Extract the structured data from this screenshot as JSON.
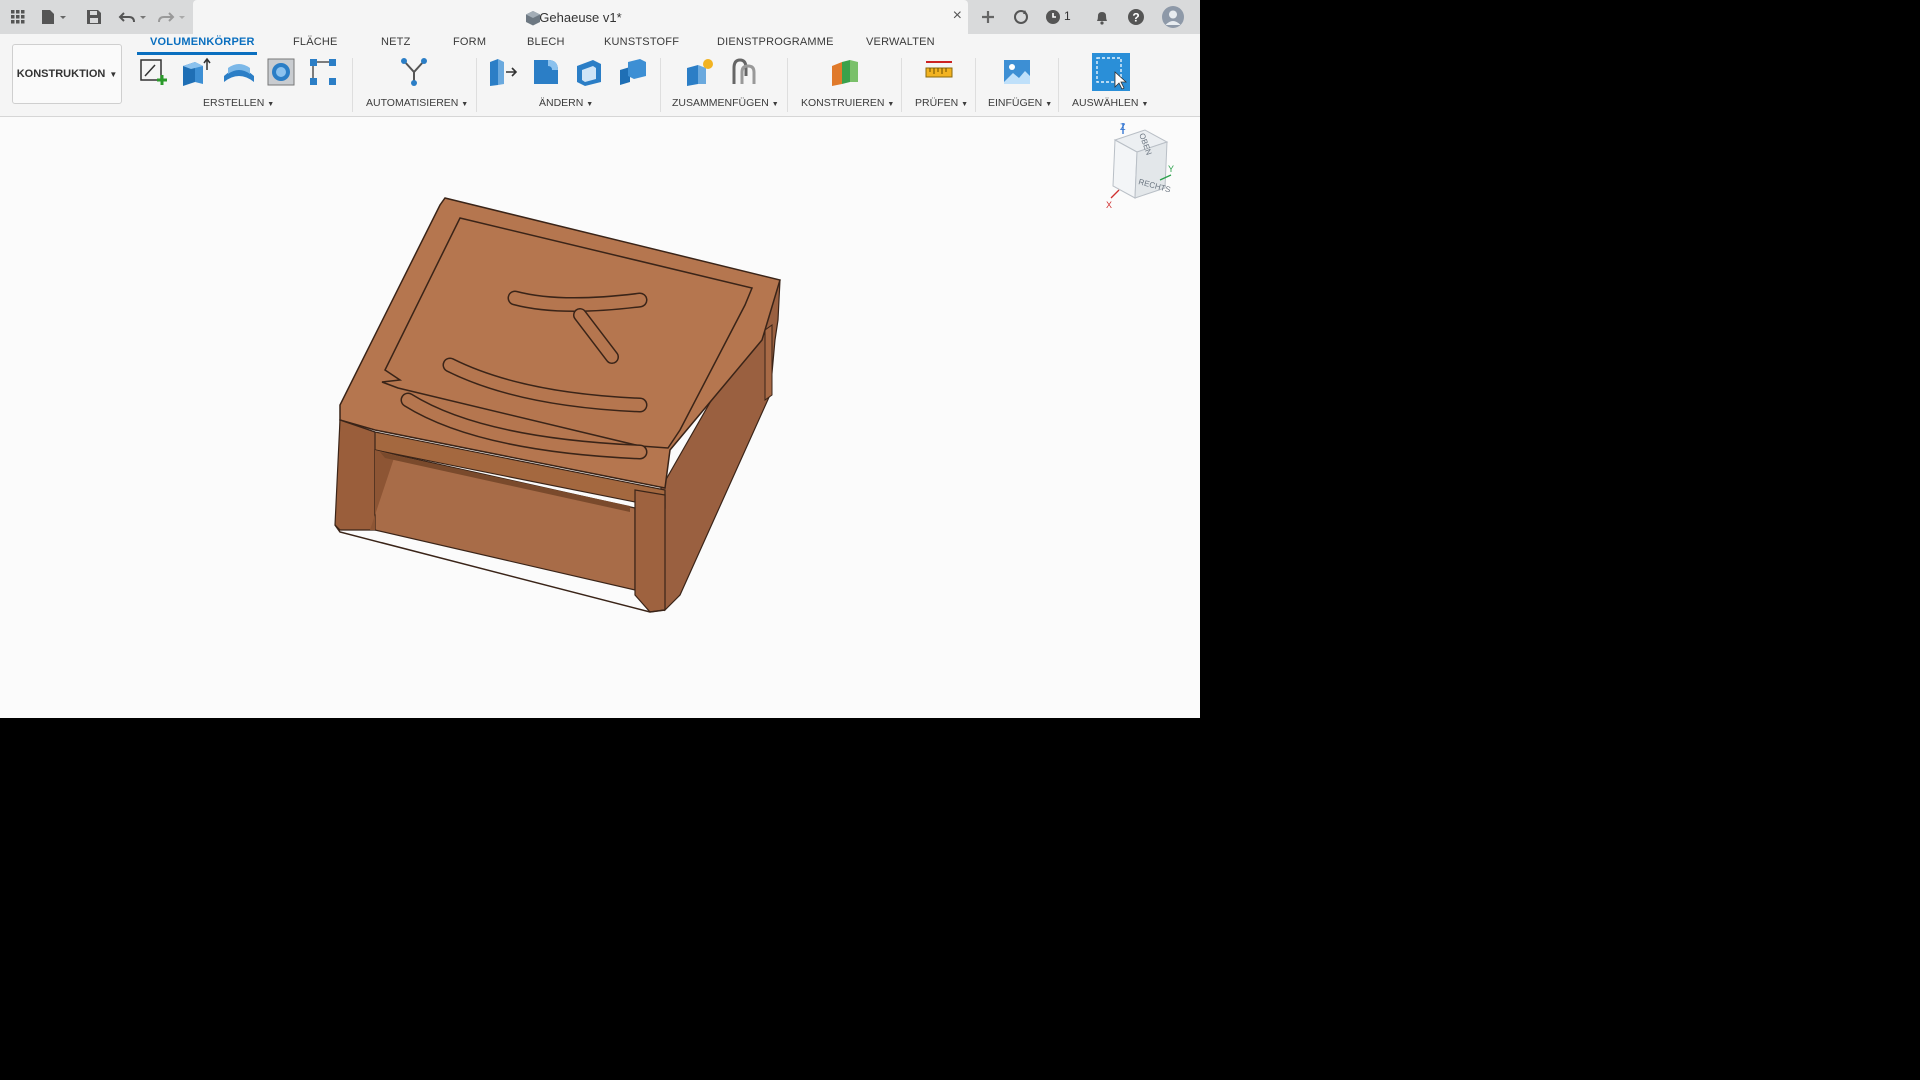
{
  "document": {
    "title": "Gehaeuse v1*"
  },
  "topbar": {
    "job_count": "1"
  },
  "ribbon": {
    "tabs": [
      {
        "label": "VOLUMENKÖRPER",
        "active": true
      },
      {
        "label": "FLÄCHE"
      },
      {
        "label": "NETZ"
      },
      {
        "label": "FORM"
      },
      {
        "label": "BLECH"
      },
      {
        "label": "KUNSTSTOFF"
      },
      {
        "label": "DIENSTPROGRAMME"
      },
      {
        "label": "VERWALTEN"
      }
    ],
    "workspace": "KONSTRUKTION",
    "groups": [
      {
        "label": "ERSTELLEN"
      },
      {
        "label": "AUTOMATISIEREN"
      },
      {
        "label": "ÄNDERN"
      },
      {
        "label": "ZUSAMMENFÜGEN"
      },
      {
        "label": "KONSTRUIEREN"
      },
      {
        "label": "PRÜFEN"
      },
      {
        "label": "EINFÜGEN"
      },
      {
        "label": "AUSWÄHLEN"
      }
    ]
  },
  "viewcube": {
    "top_label": "OBEN",
    "right_label": "RECHTS",
    "axes": [
      "Z",
      "Y",
      "X"
    ]
  },
  "colors": {
    "accent": "#0a6fbf",
    "model": "#b0704a",
    "model_dark": "#8a5434",
    "model_light": "#c07f58"
  }
}
